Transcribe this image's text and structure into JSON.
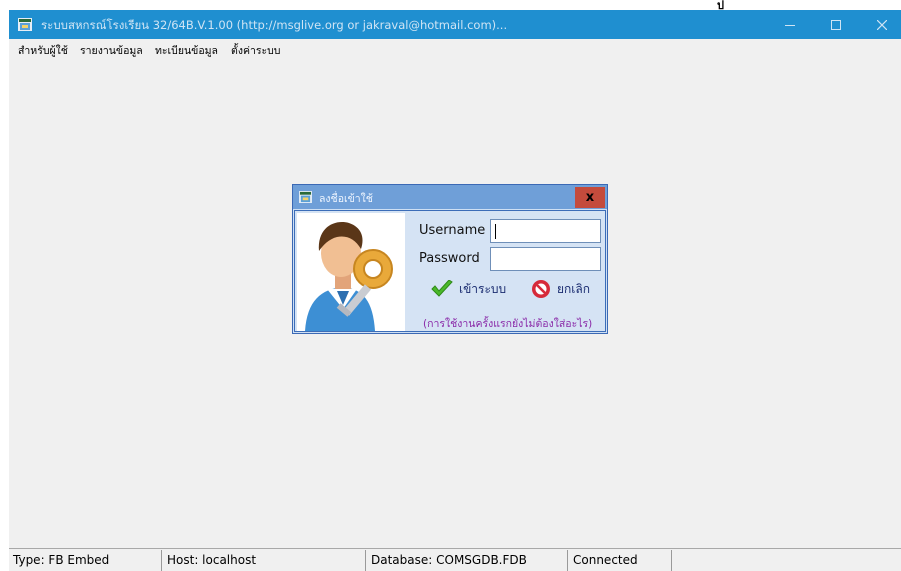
{
  "window": {
    "title": "ระบบสหกรณ์โรงเรียน 32/64B.V.1.00 (http://msglive.org or jakraval@hotmail.com)...",
    "top_mark": "ป"
  },
  "menu": {
    "items": [
      {
        "label": "สำหรับผู้ใช้"
      },
      {
        "label": "รายงานข้อมูล"
      },
      {
        "label": "ทะเบียนข้อมูล"
      },
      {
        "label": "ตั้งค่าระบบ"
      }
    ]
  },
  "login_dialog": {
    "title": "ลงชื่อเข้าใช้",
    "close_label": "x",
    "username_label": "Username",
    "username_value": "",
    "password_label": "Password",
    "password_value": "",
    "login_label": "เข้าระบบ",
    "cancel_label": "ยกเลิก",
    "hint": "(การใช้งานครั้งแรกยังไม่ต้องใส่อะไร)"
  },
  "statusbar": {
    "type": "Type: FB Embed",
    "host": "Host: localhost",
    "database": "Database: COMSGDB.FDB",
    "status": "Connected"
  },
  "icons": {
    "app": "app-window-icon",
    "user": "user-key-icon",
    "login": "checkmark-icon",
    "cancel": "no-entry-icon"
  },
  "colors": {
    "titlebar": "#1f8fd0",
    "dialog_title": "#6f9fd8",
    "dialog_close": "#c44b3c",
    "hint_text": "#8a2aa8",
    "button_text": "#1a2c70"
  }
}
